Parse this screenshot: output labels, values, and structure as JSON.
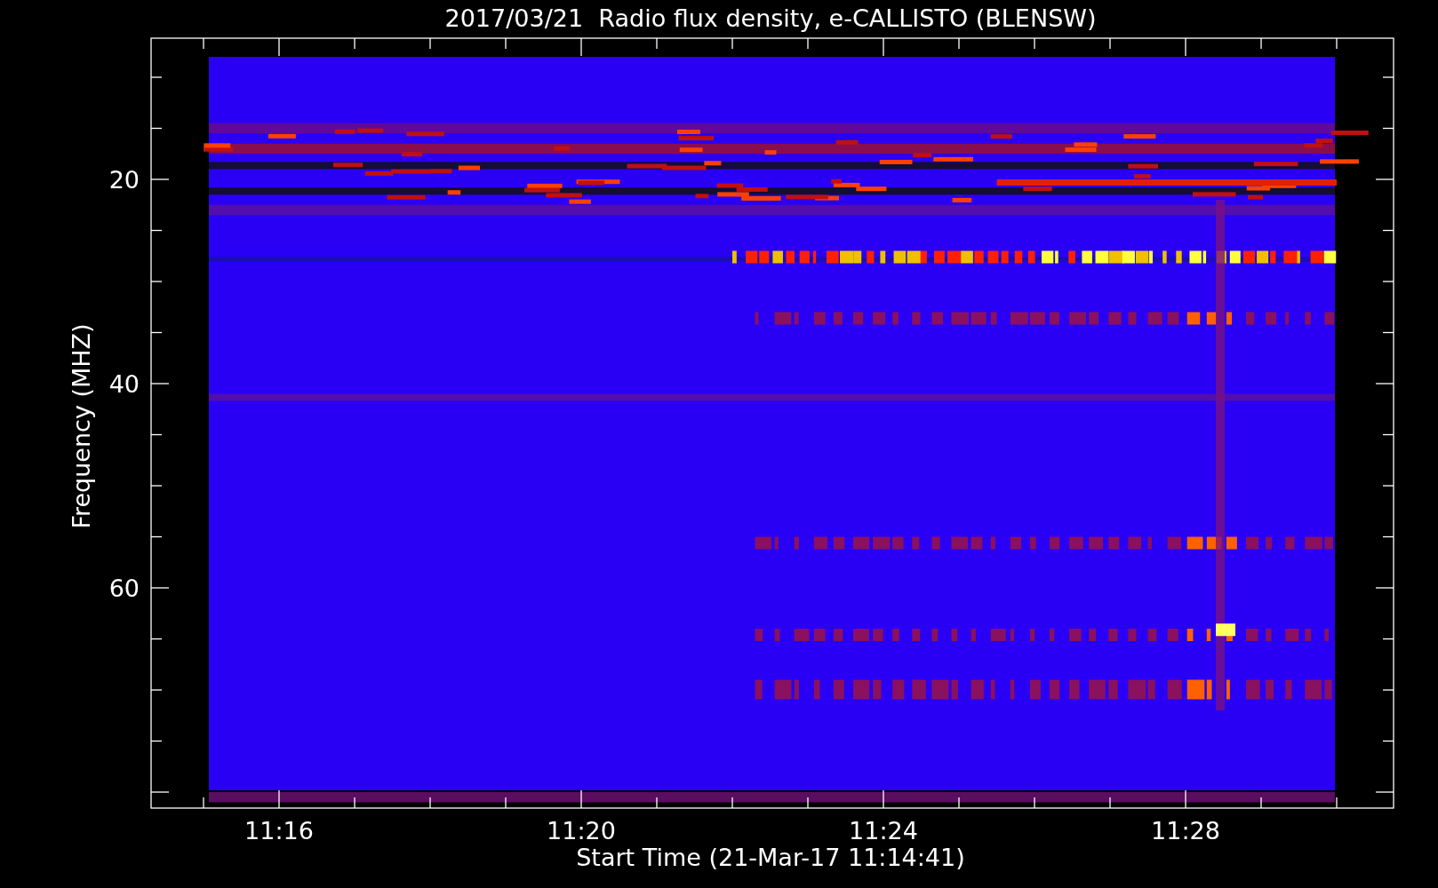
{
  "title": "2017/03/21  Radio flux density, e-CALLISTO (BLENSW)",
  "y_axis": {
    "label": "Frequency (MHZ)",
    "ticks": [
      "20",
      "40",
      "60"
    ]
  },
  "x_axis": {
    "label": "Start Time (21-Mar-17 11:14:41)",
    "ticks": [
      "11:16",
      "11:20",
      "11:24",
      "11:28"
    ]
  }
}
